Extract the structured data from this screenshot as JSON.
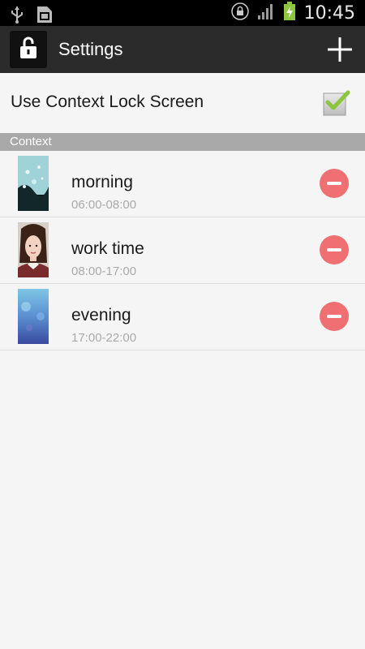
{
  "status_bar": {
    "time": "10:45",
    "icons": [
      "usb-icon",
      "sd-card-icon",
      "lock-icon",
      "signal-icon",
      "battery-charging-icon"
    ]
  },
  "action_bar": {
    "title": "Settings",
    "app_icon": "unlock-icon",
    "add_icon": "plus-icon"
  },
  "toggle": {
    "label": "Use Context Lock Screen",
    "checked": true
  },
  "section": {
    "title": "Context"
  },
  "contexts": [
    {
      "name": "morning",
      "time": "06:00-08:00"
    },
    {
      "name": "work time",
      "time": "08:00-17:00"
    },
    {
      "name": "evening",
      "time": "17:00-22:00"
    }
  ],
  "colors": {
    "status_bar": "#000000",
    "action_bar": "#2b2b2b",
    "section_header": "#a9a9a9",
    "remove_button": "#ef6f72",
    "check_mark": "#8cc63f"
  }
}
